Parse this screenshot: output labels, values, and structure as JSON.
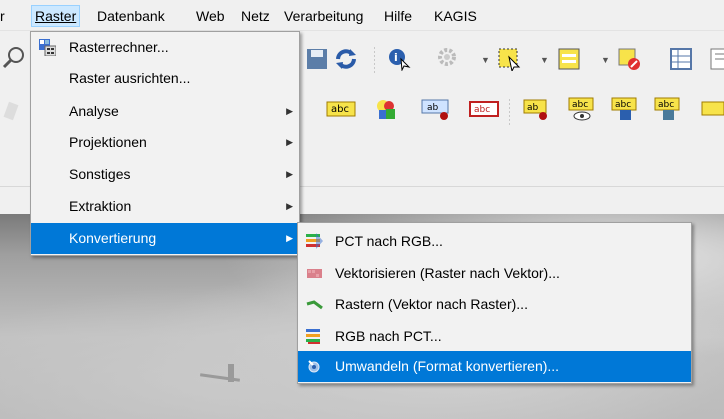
{
  "menubar": {
    "items": [
      {
        "label": "r"
      },
      {
        "label": "Raster"
      },
      {
        "label": "Datenbank"
      },
      {
        "label": "Web"
      },
      {
        "label": "Netz"
      },
      {
        "label": "Verarbeitung"
      },
      {
        "label": "Hilfe"
      },
      {
        "label": "KAGIS"
      }
    ]
  },
  "raster_menu": {
    "items": [
      {
        "label": "Rasterrechner...",
        "icon": "raster-calculator-icon"
      },
      {
        "label": "Raster ausrichten..."
      },
      {
        "label": "Analyse",
        "submenu": true
      },
      {
        "label": "Projektionen",
        "submenu": true
      },
      {
        "label": "Sonstiges",
        "submenu": true
      },
      {
        "label": "Extraktion",
        "submenu": true
      },
      {
        "label": "Konvertierung",
        "submenu": true,
        "highlighted": true
      }
    ]
  },
  "konvertierung_menu": {
    "items": [
      {
        "label": "PCT nach RGB...",
        "icon": "pct-to-rgb-icon"
      },
      {
        "label": "Vektorisieren (Raster nach Vektor)...",
        "icon": "polygonize-icon"
      },
      {
        "label": "Rastern (Vektor nach Raster)...",
        "icon": "rasterize-icon"
      },
      {
        "label": "RGB nach PCT...",
        "icon": "rgb-to-pct-icon"
      },
      {
        "label": "Umwandeln (Format konvertieren)...",
        "icon": "translate-icon",
        "highlighted": true
      }
    ]
  },
  "toolbar_labels": {
    "abc": "abc",
    "ab": "ab"
  },
  "colors": {
    "highlight": "#0078d7",
    "menubar_active": "#cce8ff",
    "menu_bg": "#f2f2f2"
  }
}
